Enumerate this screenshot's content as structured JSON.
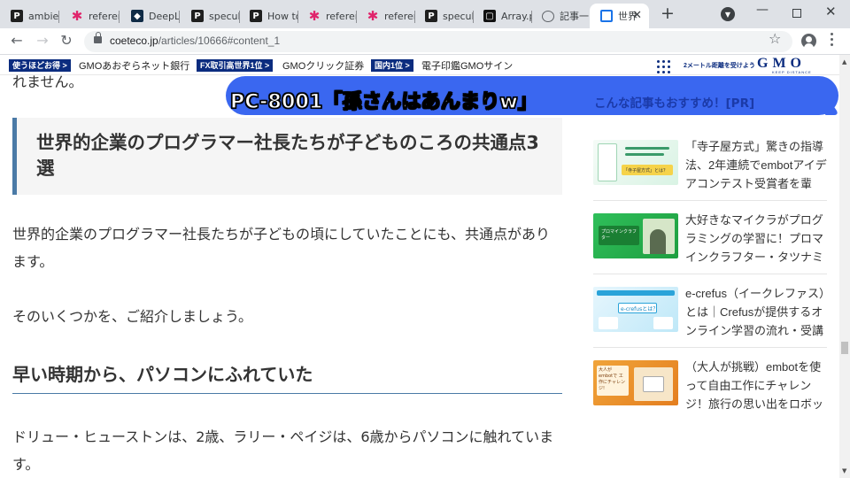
{
  "browser": {
    "tabs": [
      {
        "title": "ambient",
        "icon": "perplexity-icon"
      },
      {
        "title": "referen",
        "icon": "star-icon"
      },
      {
        "title": "DeepL",
        "icon": "deepl-icon"
      },
      {
        "title": "specul",
        "icon": "perplexity-icon"
      },
      {
        "title": "How to",
        "icon": "perplexity-icon"
      },
      {
        "title": "referen",
        "icon": "star-icon"
      },
      {
        "title": "referen",
        "icon": "star-icon"
      },
      {
        "title": "specul",
        "icon": "perplexity-icon"
      },
      {
        "title": "Array.p",
        "icon": "array-icon"
      },
      {
        "title": "記事一",
        "icon": "globe-icon"
      },
      {
        "title": "世界",
        "icon": "coeteco-icon",
        "active": true
      }
    ],
    "new_tab": "+",
    "url_domain": "coeteco.jp",
    "url_path": "/articles/10666#content_1"
  },
  "adbar": {
    "items": [
      {
        "tag": "使うほどお得 >",
        "link": "GMOあおぞらネット銀行"
      },
      {
        "tag": "FX取引高世界1位 >",
        "link": "GMOクリック証券"
      },
      {
        "tag": "国内1位 >",
        "link": "電子印鑑GMOサイン"
      }
    ],
    "slogan": "2メートル距離を受けよう",
    "logo": "GMO",
    "logo_sub": "KEEP DISTANCE"
  },
  "article": {
    "prev_text": "れません。",
    "heading": "世界的企業のプログラマー社長たちが子どものころの共通点3選",
    "para1": "世界的企業のプログラマー社長たちが子どもの頃にしていたことにも、共通点があります。",
    "para2": "そのいくつかを、ご紹介しましょう。",
    "subheading": "早い時期から、パソコンにふれていた",
    "para3": "ドリュー・ヒューストンは、2歳、ラリー・ペイジは、6歳からパソコンに触れています。"
  },
  "overlay": {
    "video_title": "PC-8001「孫さんはあんまりw」",
    "recommend_label": "こんな記事もおすすめ！[PR]"
  },
  "sidebar": {
    "items": [
      {
        "text": "「寺子屋方式」驚きの指導法、2年連続でembotアイデアコンテスト受賞者を輩出…",
        "thumb_caption": "「寺子屋方式」とは？"
      },
      {
        "text": "大好きなマイクラがプログラミングの学習に！プロマインクラフター・タツナミさん…",
        "thumb_caption": "プロマインクラフター"
      },
      {
        "text": "e-crefus（イークレファス）とは｜Crefusが提供するオンライン学習の流れ・受講料…",
        "thumb_caption": "e-crefusとは？"
      },
      {
        "text": "（大人が挑戦）embotを使って自由工作にチャレンジ！旅行の思い出をロボットにし…",
        "thumb_caption": "大人が embotで 工作にチャレンジ!"
      }
    ]
  },
  "colors": {
    "accent": "#4a7aa6",
    "bubble": "#3a67f0",
    "gmo_navy": "#0b2c7f"
  }
}
